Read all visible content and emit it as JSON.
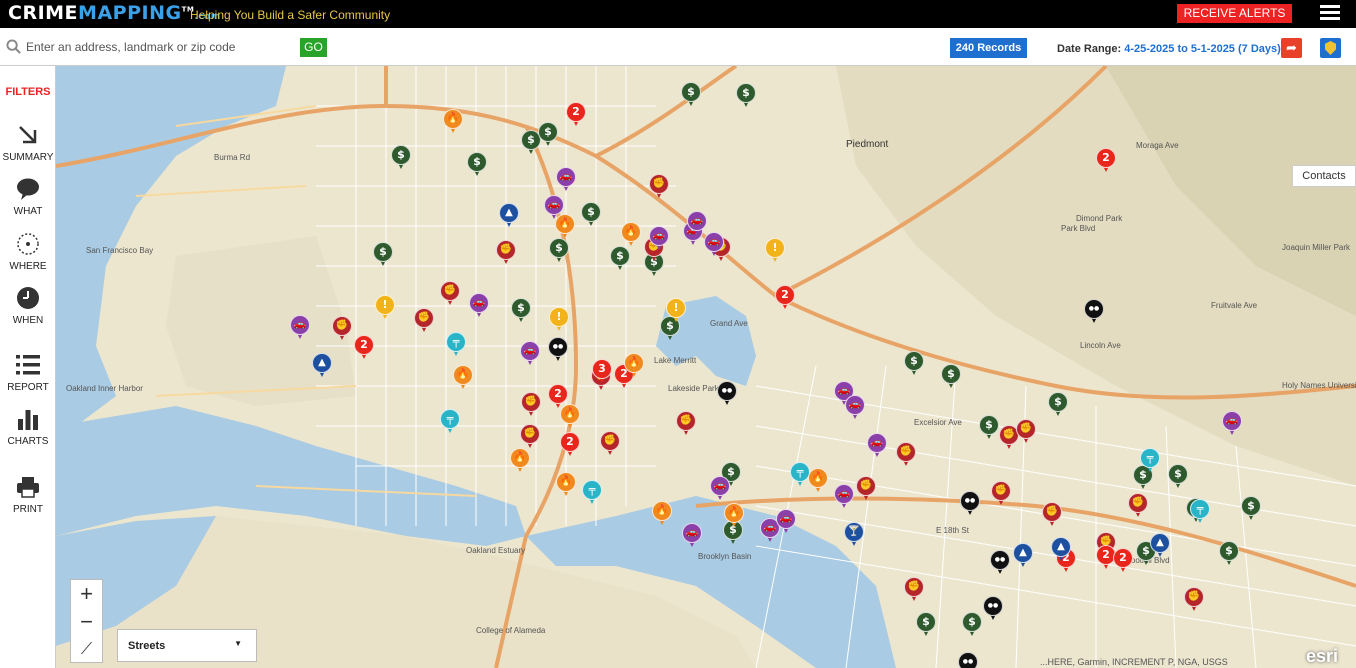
{
  "header": {
    "logo_part1": "CRIME",
    "logo_part2": "MAPPING",
    "logo_tm": "TM",
    "logo_suffix": ".com",
    "tagline": "Helping You Build a Safer Community",
    "receive_alerts": "RECEIVE ALERTS"
  },
  "search": {
    "placeholder": "Enter an address, landmark or zip code",
    "go_label": "GO",
    "records_label": "240 Records",
    "date_range_label": "Date Range:",
    "date_range_value": "4-25-2025 to 5-1-2025 (7 Days)"
  },
  "sidebar": {
    "filters_label": "FILTERS",
    "items": [
      {
        "label": "SUMMARY",
        "icon": "arrow-icon"
      },
      {
        "label": "WHAT",
        "icon": "speech-bubble-icon"
      },
      {
        "label": "WHERE",
        "icon": "target-icon"
      },
      {
        "label": "WHEN",
        "icon": "clock-icon"
      },
      {
        "label": "REPORT",
        "icon": "list-icon"
      },
      {
        "label": "CHARTS",
        "icon": "bar-chart-icon"
      },
      {
        "label": "PRINT",
        "icon": "printer-icon"
      }
    ]
  },
  "map": {
    "contacts_label": "Contacts",
    "basemap_label": "Streets",
    "zoom_in": "+",
    "zoom_out": "−",
    "esri": "esri",
    "attribution": "...HERE, Garmin, INCREMENT P, NGA, USGS",
    "labels": [
      {
        "text": "Piedmont",
        "cls": "big"
      },
      {
        "text": "San Francisco Bay",
        "cls": ""
      },
      {
        "text": "Oakland Inner Harbor",
        "cls": ""
      },
      {
        "text": "Lake Merritt",
        "cls": ""
      },
      {
        "text": "Brooklyn Basin",
        "cls": ""
      },
      {
        "text": "Lakeside Park",
        "cls": ""
      },
      {
        "text": "Burma Rd",
        "cls": ""
      },
      {
        "text": "Grand Ave",
        "cls": ""
      },
      {
        "text": "Excelsior Ave",
        "cls": ""
      },
      {
        "text": "Park Blvd",
        "cls": ""
      },
      {
        "text": "Lincoln Ave",
        "cls": ""
      },
      {
        "text": "Fruitvale Ave",
        "cls": ""
      },
      {
        "text": "Foothill Blvd",
        "cls": ""
      },
      {
        "text": "E 18th St",
        "cls": ""
      },
      {
        "text": "Dimond Park",
        "cls": ""
      },
      {
        "text": "Joaquin Miller Park",
        "cls": ""
      },
      {
        "text": "Holy Names University",
        "cls": ""
      },
      {
        "text": "Moraga Ave",
        "cls": ""
      },
      {
        "text": "Oakland Estuary",
        "cls": ""
      },
      {
        "text": "College of Alameda",
        "cls": ""
      }
    ]
  },
  "pin_colors": {
    "theft": "#2e5a2e",
    "assault": "#b5262b",
    "vehicle": "#8b3fa8",
    "multi": "#e8261c",
    "arson": "#f08a1e",
    "robbery": "#111111",
    "weapons": "#29b4c8",
    "dui": "#1e50a0",
    "other": "#f2b31a"
  },
  "pins": [
    {
      "type": "theft",
      "label": "$"
    },
    {
      "type": "theft",
      "label": "$"
    },
    {
      "type": "theft",
      "label": "$"
    },
    {
      "type": "theft",
      "label": "$"
    },
    {
      "type": "theft",
      "label": "$"
    },
    {
      "type": "theft",
      "label": "$"
    },
    {
      "type": "theft",
      "label": "$"
    },
    {
      "type": "theft",
      "label": "$"
    },
    {
      "type": "theft",
      "label": "$"
    },
    {
      "type": "theft",
      "label": "$"
    },
    {
      "type": "theft",
      "label": "$"
    },
    {
      "type": "theft",
      "label": "$"
    },
    {
      "type": "theft",
      "label": "$"
    },
    {
      "type": "theft",
      "label": "$"
    },
    {
      "type": "theft",
      "label": "$"
    },
    {
      "type": "theft",
      "label": "$"
    },
    {
      "type": "theft",
      "label": "$"
    },
    {
      "type": "theft",
      "label": "$"
    },
    {
      "type": "theft",
      "label": "$"
    },
    {
      "type": "theft",
      "label": "$"
    },
    {
      "type": "theft",
      "label": "$"
    },
    {
      "type": "theft",
      "label": "$"
    },
    {
      "type": "theft",
      "label": "$"
    },
    {
      "type": "theft",
      "label": "$"
    },
    {
      "type": "theft",
      "label": "$"
    },
    {
      "type": "theft",
      "label": "$"
    },
    {
      "type": "theft",
      "label": "$"
    },
    {
      "type": "assault",
      "label": "✊"
    },
    {
      "type": "assault",
      "label": "✊"
    },
    {
      "type": "assault",
      "label": "✊"
    },
    {
      "type": "assault",
      "label": "✊"
    },
    {
      "type": "assault",
      "label": "✊"
    },
    {
      "type": "assault",
      "label": "✊"
    },
    {
      "type": "assault",
      "label": "✊"
    },
    {
      "type": "assault",
      "label": "✊"
    },
    {
      "type": "assault",
      "label": "✊"
    },
    {
      "type": "assault",
      "label": "✊"
    },
    {
      "type": "assault",
      "label": "✊"
    },
    {
      "type": "assault",
      "label": "✊"
    },
    {
      "type": "assault",
      "label": "✊"
    },
    {
      "type": "assault",
      "label": "✊"
    },
    {
      "type": "assault",
      "label": "✊"
    },
    {
      "type": "assault",
      "label": "✊"
    },
    {
      "type": "assault",
      "label": "✊"
    },
    {
      "type": "assault",
      "label": "✊"
    },
    {
      "type": "assault",
      "label": "✊"
    },
    {
      "type": "assault",
      "label": "✊"
    },
    {
      "type": "assault",
      "label": "✊"
    },
    {
      "type": "assault",
      "label": "✊"
    },
    {
      "type": "vehicle",
      "label": "🚗"
    },
    {
      "type": "vehicle",
      "label": "🚗"
    },
    {
      "type": "vehicle",
      "label": "🚗"
    },
    {
      "type": "vehicle",
      "label": "🚗"
    },
    {
      "type": "vehicle",
      "label": "🚗"
    },
    {
      "type": "vehicle",
      "label": "🚗"
    },
    {
      "type": "vehicle",
      "label": "🚗"
    },
    {
      "type": "vehicle",
      "label": "🚗"
    },
    {
      "type": "vehicle",
      "label": "🚗"
    },
    {
      "type": "vehicle",
      "label": "🚗"
    },
    {
      "type": "vehicle",
      "label": "🚗"
    },
    {
      "type": "vehicle",
      "label": "🚗"
    },
    {
      "type": "vehicle",
      "label": "🚗"
    },
    {
      "type": "vehicle",
      "label": "🚗"
    },
    {
      "type": "vehicle",
      "label": "🚗"
    },
    {
      "type": "vehicle",
      "label": "🚗"
    },
    {
      "type": "vehicle",
      "label": "🚗"
    },
    {
      "type": "vehicle",
      "label": "🚗"
    },
    {
      "type": "multi",
      "label": "2"
    },
    {
      "type": "multi",
      "label": "2"
    },
    {
      "type": "multi",
      "label": "2"
    },
    {
      "type": "multi",
      "label": "2"
    },
    {
      "type": "multi",
      "label": "2"
    },
    {
      "type": "multi",
      "label": "2"
    },
    {
      "type": "multi",
      "label": "2"
    },
    {
      "type": "multi",
      "label": "2"
    },
    {
      "type": "multi",
      "label": "3"
    },
    {
      "type": "multi",
      "label": "2"
    },
    {
      "type": "multi",
      "label": "2"
    },
    {
      "type": "arson",
      "label": "🔥"
    },
    {
      "type": "arson",
      "label": "🔥"
    },
    {
      "type": "arson",
      "label": "🔥"
    },
    {
      "type": "arson",
      "label": "🔥"
    },
    {
      "type": "arson",
      "label": "🔥"
    },
    {
      "type": "arson",
      "label": "🔥"
    },
    {
      "type": "arson",
      "label": "🔥"
    },
    {
      "type": "arson",
      "label": "🔥"
    },
    {
      "type": "arson",
      "label": "🔥"
    },
    {
      "type": "arson",
      "label": "🔥"
    },
    {
      "type": "arson",
      "label": "🔥"
    },
    {
      "type": "robbery",
      "label": "●●"
    },
    {
      "type": "robbery",
      "label": "●●"
    },
    {
      "type": "robbery",
      "label": "●●"
    },
    {
      "type": "robbery",
      "label": "●●"
    },
    {
      "type": "robbery",
      "label": "●●"
    },
    {
      "type": "robbery",
      "label": "●●"
    },
    {
      "type": "robbery",
      "label": "●●"
    },
    {
      "type": "weapons",
      "label": "╤"
    },
    {
      "type": "weapons",
      "label": "╤"
    },
    {
      "type": "weapons",
      "label": "╤"
    },
    {
      "type": "weapons",
      "label": "╤"
    },
    {
      "type": "weapons",
      "label": "╤"
    },
    {
      "type": "weapons",
      "label": "╤"
    },
    {
      "type": "dui",
      "label": "🍸"
    },
    {
      "type": "dui",
      "label": "▲"
    },
    {
      "type": "dui",
      "label": "▲"
    },
    {
      "type": "dui",
      "label": "▲"
    },
    {
      "type": "dui",
      "label": "▲"
    },
    {
      "type": "dui",
      "label": "▲"
    },
    {
      "type": "other",
      "label": "!"
    },
    {
      "type": "other",
      "label": "!"
    },
    {
      "type": "other",
      "label": "!"
    },
    {
      "type": "other",
      "label": "!"
    }
  ]
}
